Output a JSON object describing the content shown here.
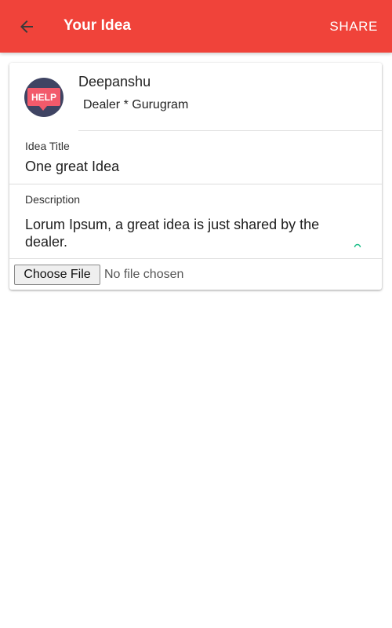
{
  "header": {
    "title": "Your Idea",
    "share_label": "SHARE",
    "back_icon": "arrow-back-icon",
    "background_color": "#f0433a"
  },
  "user": {
    "name": "Deepanshu",
    "meta": "Dealer * Gurugram",
    "avatar_text": "HELP",
    "avatar_icon": "help-speech-bubble-icon"
  },
  "idea": {
    "title_label": "Idea Title",
    "title_value": "One great Idea",
    "description_label": "Description",
    "description_value": "Lorum Ipsum, a great idea is just shared by the dealer."
  },
  "file_input": {
    "button_label": "Choose File",
    "status": "No file chosen"
  }
}
